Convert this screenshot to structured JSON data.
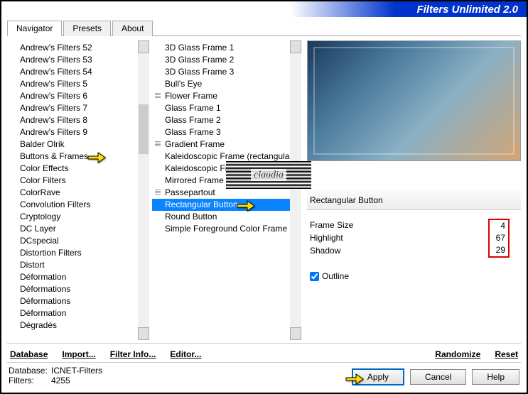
{
  "title": "Filters Unlimited 2.0",
  "tabs": [
    {
      "label": "Navigator",
      "active": true
    },
    {
      "label": "Presets",
      "active": false
    },
    {
      "label": "About",
      "active": false
    }
  ],
  "categories": [
    "Andrew's Filters 52",
    "Andrew's Filters 53",
    "Andrew's Filters 54",
    "Andrew's Filters 5",
    "Andrew's Filters 6",
    "Andrew's Filters 7",
    "Andrew's Filters 8",
    "Andrew's Filters 9",
    "Balder Olrik",
    "Buttons & Frames",
    "Color Effects",
    "Color Filters",
    "ColorRave",
    "Convolution Filters",
    "Cryptology",
    "DC Layer",
    "DCspecial",
    "Distortion Filters",
    "Distort",
    "Déformation",
    "Déformations",
    "Déformations",
    "Déformation",
    "Dégradés"
  ],
  "selectedCategoryIndex": 9,
  "filters": [
    {
      "label": "3D Glass Frame 1",
      "grp": false
    },
    {
      "label": "3D Glass Frame 2",
      "grp": false
    },
    {
      "label": "3D Glass Frame 3",
      "grp": false
    },
    {
      "label": "Bull's Eye",
      "grp": false
    },
    {
      "label": "Flower Frame",
      "grp": true
    },
    {
      "label": "Glass Frame 1",
      "grp": false
    },
    {
      "label": "Glass Frame 2",
      "grp": false
    },
    {
      "label": "Glass Frame 3",
      "grp": false
    },
    {
      "label": "Gradient Frame",
      "grp": true
    },
    {
      "label": "Kaleidoscopic Frame (rectangular)",
      "grp": false
    },
    {
      "label": "Kaleidoscopic Frame (round)",
      "grp": false
    },
    {
      "label": "Mirrored Frame",
      "grp": false
    },
    {
      "label": "Passepartout",
      "grp": true
    },
    {
      "label": "Rectangular Button",
      "grp": false
    },
    {
      "label": "Round Button",
      "grp": false
    },
    {
      "label": "Simple Foreground Color Frame",
      "grp": false
    }
  ],
  "selectedFilterIndex": 13,
  "watermark": "claudia",
  "paramTitle": "Rectangular Button",
  "params": [
    {
      "name": "Frame Size",
      "value": 4
    },
    {
      "name": "Highlight",
      "value": 67
    },
    {
      "name": "Shadow",
      "value": 29
    }
  ],
  "outline": {
    "label": "Outline",
    "checked": true
  },
  "btns": {
    "database": "Database",
    "import": "Import...",
    "filterinfo": "Filter Info...",
    "editor": "Editor...",
    "randomize": "Randomize",
    "reset": "Reset"
  },
  "status": {
    "dbLabel": "Database:",
    "dbValue": "ICNET-Filters",
    "filtersLabel": "Filters:",
    "filtersValue": "4255"
  },
  "winbtns": {
    "apply": "Apply",
    "cancel": "Cancel",
    "help": "Help"
  }
}
